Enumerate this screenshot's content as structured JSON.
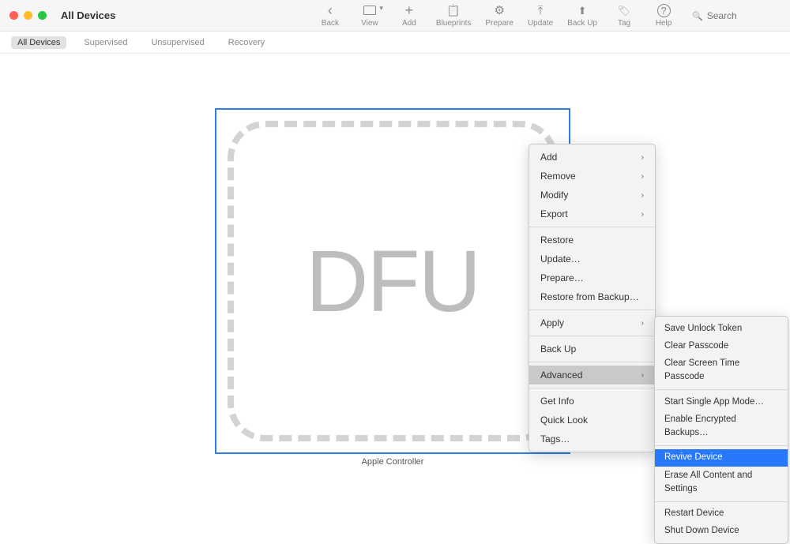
{
  "window": {
    "title": "All Devices"
  },
  "toolbar": {
    "back": "Back",
    "view": "View",
    "add": "Add",
    "blueprints": "Blueprints",
    "prepare": "Prepare",
    "update": "Update",
    "backup": "Back Up",
    "tag": "Tag",
    "help": "Help",
    "search_placeholder": "Search"
  },
  "filters": {
    "all": "All Devices",
    "supervised": "Supervised",
    "unsupervised": "Unsupervised",
    "recovery": "Recovery"
  },
  "device": {
    "mode": "DFU",
    "name": "Apple Controller"
  },
  "context_menu": {
    "add": "Add",
    "remove": "Remove",
    "modify": "Modify",
    "export": "Export",
    "restore": "Restore",
    "update": "Update…",
    "prepare": "Prepare…",
    "restore_backup": "Restore from Backup…",
    "apply": "Apply",
    "backup": "Back Up",
    "advanced": "Advanced",
    "get_info": "Get Info",
    "quick_look": "Quick Look",
    "tags": "Tags…"
  },
  "advanced_submenu": {
    "save_unlock": "Save Unlock Token",
    "clear_passcode": "Clear Passcode",
    "clear_screen_time": "Clear Screen Time Passcode",
    "single_app": "Start Single App Mode…",
    "encrypted_backups": "Enable Encrypted Backups…",
    "revive": "Revive Device",
    "erase": "Erase All Content and Settings",
    "restart": "Restart Device",
    "shutdown": "Shut Down Device"
  }
}
